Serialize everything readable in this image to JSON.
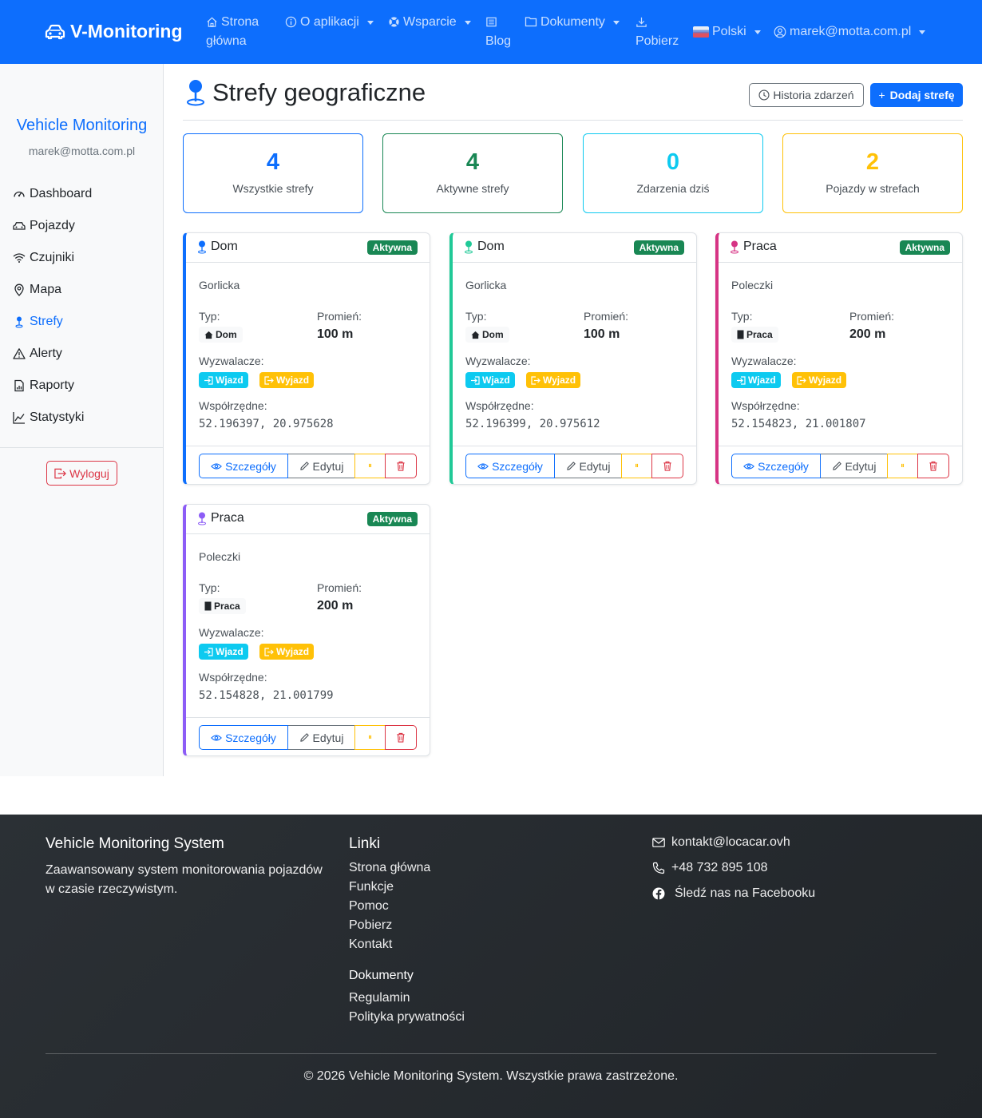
{
  "navbar": {
    "brand": "V-Monitoring",
    "items": {
      "home_line1": "Strona",
      "home_line2": "główna",
      "about": "O aplikacji",
      "support": "Wsparcie",
      "blog": "Blog",
      "documents": "Dokumenty",
      "download": "Pobierz",
      "language": "Polski",
      "user": "marek@motta.com.pl"
    }
  },
  "sidebar": {
    "title": "Vehicle Monitoring",
    "email": "marek@motta.com.pl",
    "items": [
      {
        "label": "Dashboard",
        "icon": "speedometer-icon"
      },
      {
        "label": "Pojazdy",
        "icon": "car-icon"
      },
      {
        "label": "Czujniki",
        "icon": "wifi-icon"
      },
      {
        "label": "Mapa",
        "icon": "map-pin-icon"
      },
      {
        "label": "Strefy",
        "icon": "geo-pin-icon",
        "active": true
      },
      {
        "label": "Alerty",
        "icon": "warning-icon"
      },
      {
        "label": "Raporty",
        "icon": "report-icon"
      },
      {
        "label": "Statystyki",
        "icon": "chart-line-icon"
      }
    ],
    "logout": "Wyloguj"
  },
  "page": {
    "title": "Strefy geograficzne",
    "history_button": "Historia zdarzeń",
    "add_button": "Dodaj strefę"
  },
  "stats": [
    {
      "value": "4",
      "label": "Wszystkie strefy",
      "color": "#0d6efd"
    },
    {
      "value": "4",
      "label": "Aktywne strefy",
      "color": "#198754"
    },
    {
      "value": "0",
      "label": "Zdarzenia dziś",
      "color": "#0dcaf0"
    },
    {
      "value": "2",
      "label": "Pojazdy w strefach",
      "color": "#ffc107"
    }
  ],
  "labels": {
    "type": "Typ:",
    "radius": "Promień:",
    "triggers": "Wyzwalacze:",
    "coords": "Współrzędne:",
    "active": "Aktywna",
    "entry": "Wjazd",
    "exit": "Wyjazd",
    "details": "Szczegóły",
    "edit": "Edytuj",
    "pause": "⏸"
  },
  "zones": [
    {
      "name": "Dom",
      "address": "Gorlicka",
      "type": "Dom",
      "type_icon": "house-icon",
      "radius": "100 m",
      "coords": "52.196397, 20.975628",
      "color": "#0d6efd"
    },
    {
      "name": "Dom",
      "address": "Gorlicka",
      "type": "Dom",
      "type_icon": "house-icon",
      "radius": "100 m",
      "coords": "52.196399, 20.975612",
      "color": "#20c997"
    },
    {
      "name": "Praca",
      "address": "Poleczki",
      "type": "Praca",
      "type_icon": "building-icon",
      "radius": "200 m",
      "coords": "52.154823, 21.001807",
      "color": "#d63384"
    },
    {
      "name": "Praca",
      "address": "Poleczki",
      "type": "Praca",
      "type_icon": "building-icon",
      "radius": "200 m",
      "coords": "52.154828, 21.001799",
      "color": "#8c5cf6"
    }
  ],
  "footer": {
    "title": "Vehicle Monitoring System",
    "description": "Zaawansowany system monitorowania pojazdów w czasie rzeczywistym.",
    "links_title": "Linki",
    "links": [
      "Strona główna",
      "Funkcje",
      "Pomoc",
      "Pobierz",
      "Kontakt"
    ],
    "docs_title": "Dokumenty",
    "docs": [
      "Regulamin",
      "Polityka prywatności"
    ],
    "email": "kontakt@locacar.ovh",
    "phone": "+48 732 895 108",
    "facebook": "Śledź nas na Facebooku",
    "copyright": "© 2026 Vehicle Monitoring System. Wszystkie prawa zastrzeżone."
  }
}
